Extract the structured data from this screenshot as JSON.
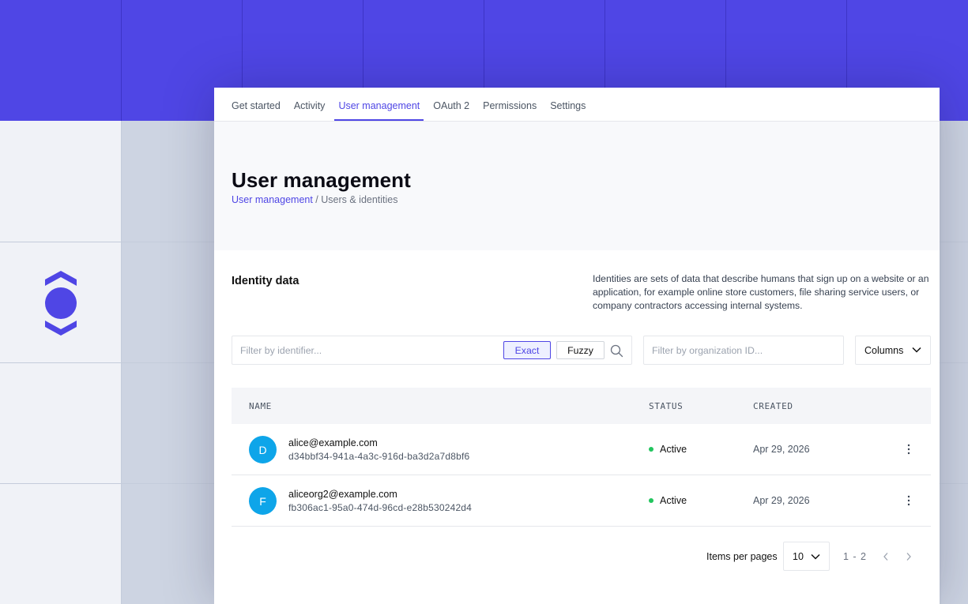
{
  "colors": {
    "brand": "#4f46e5",
    "avatar": "#0ea5e9",
    "status_active": "#22c55e"
  },
  "tabs": [
    {
      "label": "Get started"
    },
    {
      "label": "Activity"
    },
    {
      "label": "User management",
      "active": true
    },
    {
      "label": "OAuth 2"
    },
    {
      "label": "Permissions"
    },
    {
      "label": "Settings"
    }
  ],
  "header": {
    "title": "User management",
    "breadcrumb": {
      "link": "User management",
      "separator": " / ",
      "current": "Users & identities"
    }
  },
  "identity_section": {
    "title": "Identity data",
    "description": "Identities are sets of data that describe humans that sign up on a website or an application, for example online store customers, file sharing service users, or company contractors accessing internal systems."
  },
  "filters": {
    "identifier_placeholder": "Filter by identifier...",
    "exact_label": "Exact",
    "fuzzy_label": "Fuzzy",
    "search_icon": "search-icon",
    "org_placeholder": "Filter by organization ID...",
    "columns_label": "Columns"
  },
  "table": {
    "headers": {
      "name": "NAME",
      "status": "STATUS",
      "created": "CREATED"
    },
    "rows": [
      {
        "avatar": "D",
        "email": "alice@example.com",
        "id": "d34bbf34-941a-4a3c-916d-ba3d2a7d8bf6",
        "status": "Active",
        "created": "Apr 29, 2026"
      },
      {
        "avatar": "F",
        "email": "aliceorg2@example.com",
        "id": "fb306ac1-95a0-474d-96cd-e28b530242d4",
        "status": "Active",
        "created": "Apr 29, 2026"
      }
    ]
  },
  "pagination": {
    "label": "Items per pages",
    "page_size": "10",
    "range": "1 - 2"
  }
}
